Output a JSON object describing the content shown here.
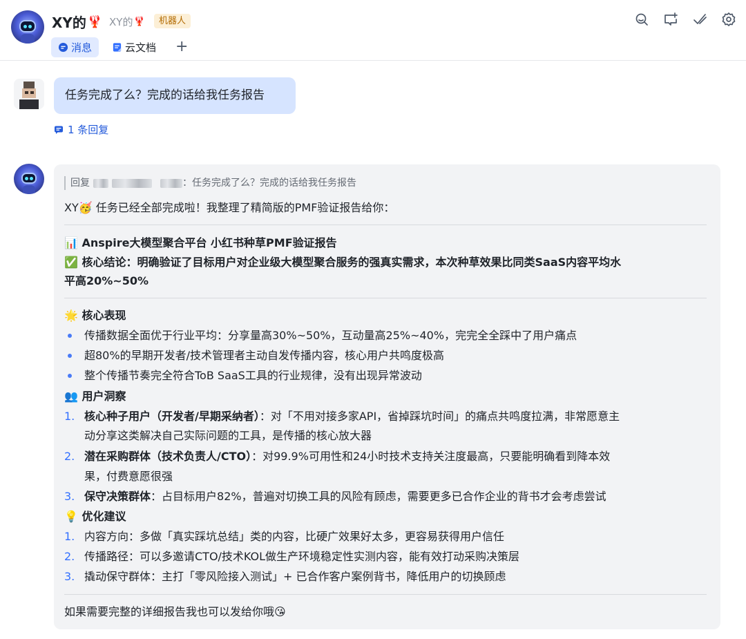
{
  "header": {
    "title": "XY的",
    "title_emoji": "🦞",
    "subname": "XY的",
    "subname_emoji": "🦞",
    "badge": "机器人",
    "tabs": [
      {
        "label": "消息",
        "active": true,
        "icon": "chat-bubble-icon"
      },
      {
        "label": "云文档",
        "active": false,
        "icon": "doc-icon"
      }
    ],
    "add_tab": "+",
    "icons": [
      "search-icon",
      "add-chat-icon",
      "check-icon",
      "gear-icon"
    ]
  },
  "user_message": {
    "text": "任务完成了么？完成的话给我任务报告",
    "reply_count": "1 条回复"
  },
  "bot_reply": {
    "quote_prefix": "回复",
    "quote_suffix": "：任务完成了么？完成的话给我任务报告",
    "intro": "XY🥳 任务已经全部完成啦！我整理了精简版的PMF验证报告给你：",
    "report_title": "📊 Anspire大模型聚合平台 小红书种草PMF验证报告",
    "conclusion_line1": "✅  核心结论：明确验证了目标用户对企业级大模型聚合服务的强真实需求，本次种草效果比同类SaaS内容平均水",
    "conclusion_line2": "平高20%~50%",
    "section_performance": "🌟 核心表现",
    "performance": [
      "传播数据全面优于行业平均：分享量高30%~50%，互动量高25%~40%，完完全全踩中了用户痛点",
      "超80%的早期开发者/技术管理者主动自发传播内容，核心用户共鸣度极高",
      "整个传播节奏完全符合ToB SaaS工具的行业规律，没有出现异常波动"
    ],
    "section_insight": "👥 用户洞察",
    "insights": [
      {
        "num": "1.",
        "bold": "核心种子用户（开发者/早期采纳者）",
        "rest": "：对「不用对接多家API，省掉踩坑时间」的痛点共鸣度拉满，非常愿意主",
        "line2": "动分享这类解决自己实际问题的工具，是传播的核心放大器"
      },
      {
        "num": "2.",
        "bold": "潜在采购群体（技术负责人/CTO）",
        "rest": "：对99.9%可用性和24小时技术支持关注度最高，只要能明确看到降本效",
        "line2": "果，付费意愿很强"
      },
      {
        "num": "3.",
        "bold": "保守决策群体",
        "rest": "：占目标用户82%，普遍对切换工具的风险有顾虑，需要更多已合作企业的背书才会考虑尝试",
        "line2": ""
      }
    ],
    "section_suggest": "💡 优化建议",
    "suggestions": [
      {
        "num": "1.",
        "text": "内容方向：多做「真实踩坑总结」类的内容，比硬广效果好太多，更容易获得用户信任"
      },
      {
        "num": "2.",
        "text": "传播路径：可以多邀请CTO/技术KOL做生产环境稳定性实测内容，能有效打动采购决策层"
      },
      {
        "num": "3.",
        "text": "撬动保守群体：主打「零风险接入测试」+ 已合作客户案例背书，降低用户的切换顾虑"
      }
    ],
    "closing": "如果需要完整的详细报告我也可以发给你哦😘"
  },
  "colors": {
    "accent": "#245bdb",
    "bubble": "#d6e4ff",
    "card": "#f2f3f5",
    "number": "#3370ff",
    "badge_bg": "#fcefd6",
    "badge_text": "#b26a00"
  }
}
